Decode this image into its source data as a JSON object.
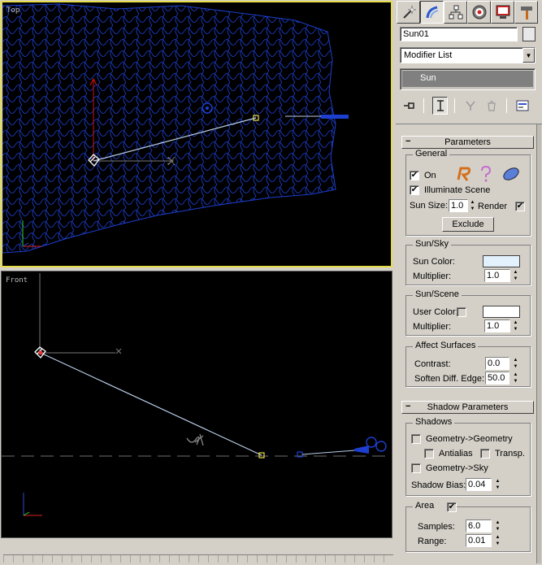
{
  "viewports": {
    "top": {
      "label": "Top"
    },
    "front": {
      "label": "Front"
    }
  },
  "command_panel": {
    "tabs": [
      "create-tab",
      "modify-tab",
      "hierarchy-tab",
      "motion-tab",
      "display-tab",
      "utilities-tab"
    ],
    "object_name": "Sun01",
    "object_color": "#e8e8e8",
    "modifier_list": "Modifier List",
    "stack_item": "Sun"
  },
  "parameters": {
    "title": "Parameters",
    "general": {
      "title": "General",
      "on_label": "On",
      "on_checked": "✔",
      "illuminate_label": "Illuminate Scene",
      "illuminate_checked": "✔",
      "sun_size_label": "Sun Size:",
      "sun_size_value": "1.0",
      "render_label": "Render",
      "render_checked": "✔",
      "exclude_label": "Exclude"
    },
    "sun_sky": {
      "title": "Sun/Sky",
      "sun_color_label": "Sun Color:",
      "sun_color": "#e3f1fc",
      "multiplier_label": "Multiplier:",
      "multiplier_value": "1.0"
    },
    "sun_scene": {
      "title": "Sun/Scene",
      "user_color_label": "User Color:",
      "user_color": "#ffffff",
      "multiplier_label": "Multiplier:",
      "multiplier_value": "1.0"
    },
    "affect_surfaces": {
      "title": "Affect Surfaces",
      "contrast_label": "Contrast:",
      "contrast_value": "0.0",
      "soften_label": "Soften Diff. Edge:",
      "soften_value": "50.0"
    }
  },
  "shadow_parameters": {
    "title": "Shadow Parameters",
    "shadows": {
      "title": "Shadows",
      "geo_geo_label": "Geometry->Geometry",
      "antialias_label": "Antialias",
      "transp_label": "Transp.",
      "geo_sky_label": "Geometry->Sky",
      "bias_label": "Shadow Bias:",
      "bias_value": "0.04"
    },
    "area": {
      "title": "Area",
      "area_checked": "✔",
      "samples_label": "Samples:",
      "samples_value": "6.0",
      "range_label": "Range:",
      "range_value": "0.01"
    }
  },
  "colors": {
    "active_viewport_border": "#e6dc48",
    "wireframe_blue": "#1d3fd0",
    "light_line": "#b9cde8",
    "target_yellow": "#e6dc48"
  }
}
